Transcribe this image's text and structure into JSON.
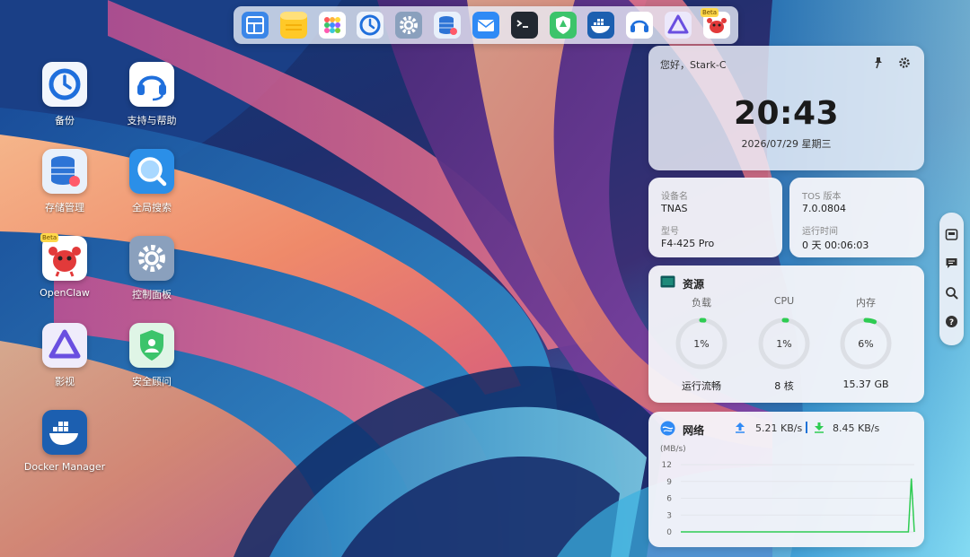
{
  "dock": {
    "items": [
      {
        "name": "file-manager",
        "icon": "file-manager-icon"
      },
      {
        "name": "notes",
        "icon": "notes-icon"
      },
      {
        "name": "app-center",
        "icon": "app-grid-icon"
      },
      {
        "name": "backup",
        "icon": "backup-clock-icon"
      },
      {
        "name": "control-panel",
        "icon": "gear-icon"
      },
      {
        "name": "storage-manager",
        "icon": "storage-icon"
      },
      {
        "name": "mail",
        "icon": "mail-icon"
      },
      {
        "name": "terminal",
        "icon": "terminal-icon"
      },
      {
        "name": "security-advisor",
        "icon": "shield-icon"
      },
      {
        "name": "docker-manager",
        "icon": "docker-icon"
      },
      {
        "name": "support",
        "icon": "headset-icon"
      },
      {
        "name": "media",
        "icon": "media-triangle-icon"
      },
      {
        "name": "openclaw",
        "icon": "crab-icon",
        "badge": "Beta"
      }
    ]
  },
  "desktop": {
    "icons": [
      {
        "label": "备份",
        "icon": "backup-clock-icon"
      },
      {
        "label": "支持与帮助",
        "icon": "headset-icon"
      },
      {
        "label": "存储管理",
        "icon": "storage-icon"
      },
      {
        "label": "全局搜索",
        "icon": "search-icon"
      },
      {
        "label": "OpenClaw",
        "icon": "crab-icon",
        "badge": "Beta"
      },
      {
        "label": "控制面板",
        "icon": "gear-icon"
      },
      {
        "label": "影视",
        "icon": "media-triangle-icon"
      },
      {
        "label": "安全顾问",
        "icon": "shield-icon"
      },
      {
        "label": "Docker Manager",
        "icon": "docker-icon"
      }
    ]
  },
  "clock": {
    "greeting": "您好，Stark-C",
    "time": "20:43",
    "date": "2026/07/29 星期三"
  },
  "device": {
    "name_label": "设备名",
    "name_value": "TNAS",
    "model_label": "型号",
    "model_value": "F4-425 Pro",
    "tos_label": "TOS 版本",
    "tos_value": "7.0.0804",
    "uptime_label": "运行时间",
    "uptime_value": "0 天 00:06:03"
  },
  "resources": {
    "title": "资源",
    "gauges": [
      {
        "title": "负载",
        "value": "1%",
        "percent": 1,
        "sub": "运行流畅"
      },
      {
        "title": "CPU",
        "value": "1%",
        "percent": 1,
        "sub": "8 核"
      },
      {
        "title": "内存",
        "value": "6%",
        "percent": 6,
        "sub": "15.37 GB"
      }
    ],
    "colors": {
      "track": "#dcdfe5",
      "fill": "#2ecc52"
    }
  },
  "network": {
    "title": "网络",
    "upload": "5.21 KB/s",
    "download": "8.45 KB/s",
    "unit": "(MB/s)",
    "chart_data": {
      "type": "line",
      "ylabel": "(MB/s)",
      "yticks": [
        "12",
        "9",
        "6",
        "3",
        "0"
      ],
      "ylim": [
        0,
        12
      ],
      "series": [
        {
          "values": [
            0,
            0,
            0,
            0,
            0,
            0,
            0,
            0,
            0,
            0,
            0,
            0,
            0,
            0,
            0,
            0,
            0,
            0,
            0,
            0,
            0,
            0,
            0,
            0,
            0,
            0,
            0,
            0,
            0,
            0,
            0,
            0,
            0,
            0,
            0,
            0,
            0,
            0,
            0,
            0,
            0,
            0,
            0,
            0,
            0,
            0,
            0,
            0,
            0,
            0,
            0,
            0,
            0,
            0,
            0,
            0,
            0,
            0,
            0,
            0,
            0,
            0,
            0,
            0,
            0,
            0,
            0,
            0,
            0,
            0,
            0,
            0,
            0,
            0,
            0,
            0,
            0,
            0,
            9.5,
            0
          ]
        }
      ],
      "grid": true,
      "color": "#2ecc52"
    }
  },
  "sidebar": {
    "items": [
      {
        "icon": "widget-icon"
      },
      {
        "icon": "message-icon"
      },
      {
        "icon": "search-icon"
      },
      {
        "icon": "help-icon"
      }
    ]
  }
}
